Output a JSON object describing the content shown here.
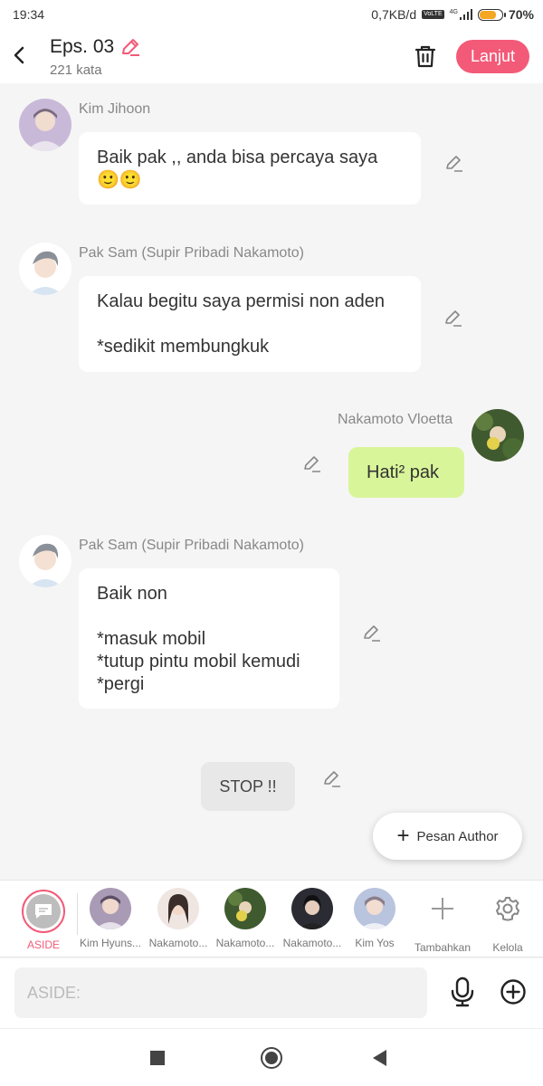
{
  "status_bar": {
    "time": "19:34",
    "network_speed": "0,7KB/d",
    "volte_badge": "VoLTE",
    "signal_tech": "4G",
    "battery": "70%",
    "battery_level": 0.7
  },
  "header": {
    "title": "Eps. 03",
    "word_count": "221 kata",
    "next_label": "Lanjut"
  },
  "messages": [
    {
      "name": "Kim Jihoon",
      "text": "Baik pak ,, anda bisa percaya saya 🙂🙂"
    },
    {
      "name": "Pak Sam (Supir Pribadi Nakamoto)",
      "text": "Kalau begitu saya permisi non aden\n\n*sedikit membungkuk"
    },
    {
      "name": "Nakamoto Vloetta",
      "text": "Hati² pak"
    },
    {
      "name": "Pak Sam (Supir Pribadi Nakamoto)",
      "text": "Baik non\n\n*masuk mobil\n*tutup pintu mobil kemudi\n*pergi"
    },
    {
      "text": "STOP !!"
    }
  ],
  "fab": {
    "label": "Pesan Author"
  },
  "character_bar": {
    "aside_label": "ASIDE",
    "characters": [
      {
        "label": "Kim Hyuns..."
      },
      {
        "label": "Nakamoto..."
      },
      {
        "label": "Nakamoto..."
      },
      {
        "label": "Nakamoto..."
      },
      {
        "label": "Kim Yos"
      }
    ],
    "add_label": "Tambahkan",
    "manage_label": "Kelola"
  },
  "input": {
    "placeholder": "ASIDE:"
  },
  "colors": {
    "accent": "#f35a78",
    "bubble_self": "#d9f59a",
    "bubble_other": "#ffffff",
    "background": "#f5f5f5"
  }
}
